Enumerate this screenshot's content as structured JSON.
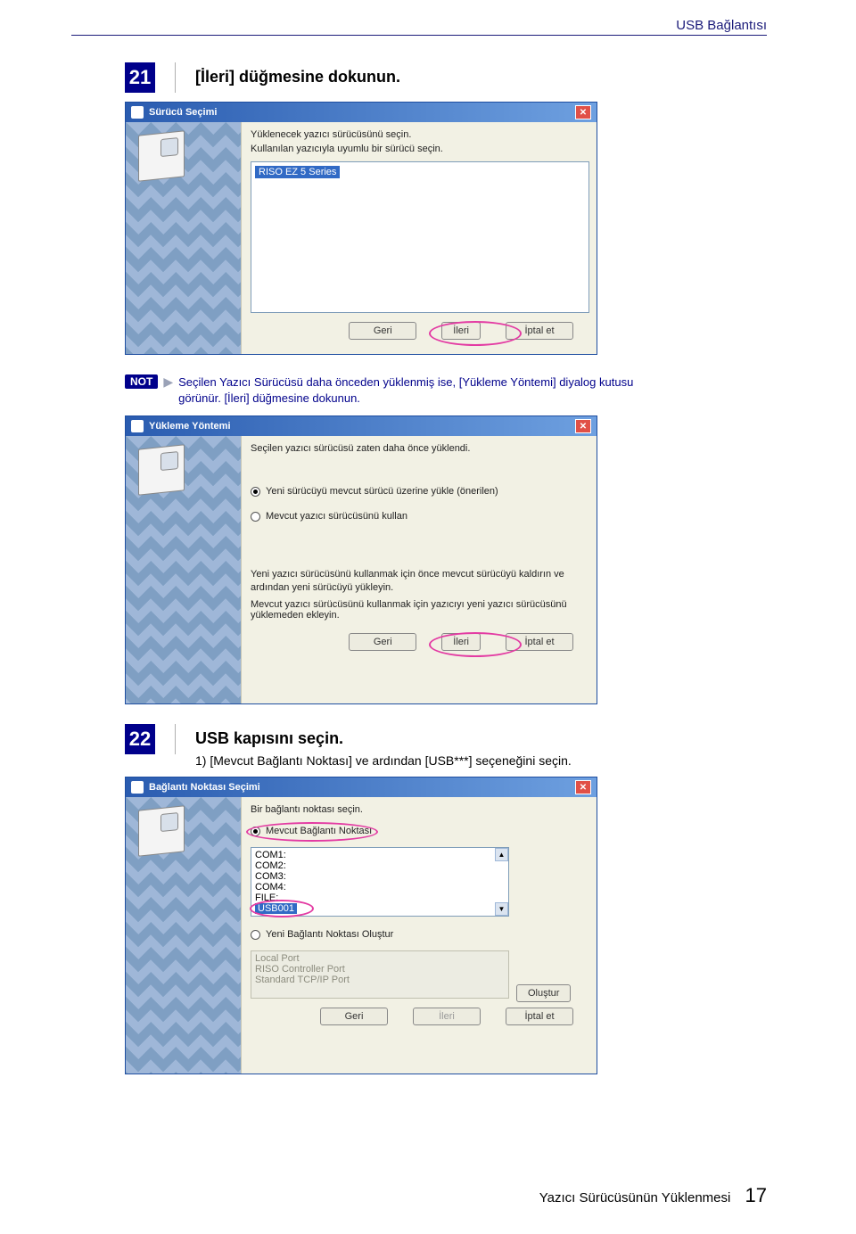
{
  "header": {
    "section": "USB Bağlantısı"
  },
  "step21": {
    "num": "21",
    "title": "[İleri] düğmesine dokunun.",
    "dialog_title": "Sürücü Seçimi",
    "line1": "Yüklenecek yazıcı sürücüsünü seçin.",
    "line2": "Kullanılan yazıcıyla uyumlu bir sürücü seçin.",
    "list_item": "RISO EZ 5 Series",
    "btn_back": "Geri",
    "btn_next": "İleri",
    "btn_cancel": "İptal et"
  },
  "note": {
    "label": "NOT",
    "text": "Seçilen Yazıcı Sürücüsü daha önceden yüklenmiş ise, [Yükleme Yöntemi] diyalog kutusu görünür. [İleri] düğmesine dokunun."
  },
  "method_dialog": {
    "title": "Yükleme Yöntemi",
    "intro": "Seçilen yazıcı sürücüsü zaten daha önce yüklendi.",
    "opt1": "Yeni sürücüyü mevcut sürücü üzerine yükle (önerilen)",
    "opt2": "Mevcut yazıcı sürücüsünü kullan",
    "desc1": "Yeni yazıcı sürücüsünü kullanmak için önce mevcut sürücüyü kaldırın ve ardından yeni sürücüyü yükleyin.",
    "desc2": "Mevcut yazıcı sürücüsünü kullanmak için yazıcıyı yeni yazıcı sürücüsünü yüklemeden ekleyin.",
    "btn_back": "Geri",
    "btn_next": "İleri",
    "btn_cancel": "İptal et"
  },
  "step22": {
    "num": "22",
    "title": "USB kapısını seçin.",
    "subtitle": "1) [Mevcut Bağlantı Noktası] ve ardından [USB***] seçeneğini seçin.",
    "dialog_title": "Bağlantı Noktası Seçimi",
    "intro": "Bir bağlantı noktası seçin.",
    "opt1": "Mevcut Bağlantı Noktası",
    "ports": {
      "p1": "COM1:",
      "p2": "COM2:",
      "p3": "COM3:",
      "p4": "COM4:",
      "p5": "FILE:",
      "p6": "USB001"
    },
    "opt2": "Yeni Bağlantı Noktası Oluştur",
    "disabled": {
      "d1": "Local Port",
      "d2": "RISO Controller Port",
      "d3": "Standard TCP/IP Port"
    },
    "btn_create": "Oluştur",
    "btn_back": "Geri",
    "btn_next": "İleri",
    "btn_cancel": "İptal et"
  },
  "footer": {
    "text": "Yazıcı Sürücüsünün Yüklenmesi",
    "page": "17"
  }
}
